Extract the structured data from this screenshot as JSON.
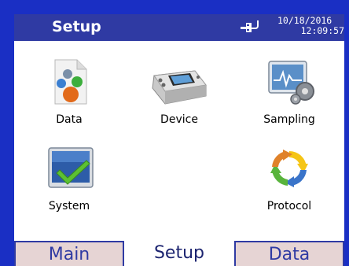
{
  "header": {
    "title": "Setup",
    "date": "10/18/2016",
    "time": "12:09:57",
    "power_icon": "plug-icon"
  },
  "menu": [
    {
      "label": "Data",
      "icon": "data-icon"
    },
    {
      "label": "Device",
      "icon": "device-icon"
    },
    {
      "label": "Sampling",
      "icon": "sampling-icon"
    },
    {
      "label": "System",
      "icon": "system-icon"
    },
    {
      "label": "Protocol",
      "icon": "protocol-icon"
    }
  ],
  "tabs": [
    {
      "label": "Main",
      "active": false
    },
    {
      "label": "Setup",
      "active": true
    },
    {
      "label": "Data",
      "active": false
    }
  ],
  "colors": {
    "frame": "#1a2fc4",
    "titlebar": "#2f3aa3",
    "tab_inactive_bg": "#e6d4d4",
    "tab_border": "#2f3aa3"
  }
}
